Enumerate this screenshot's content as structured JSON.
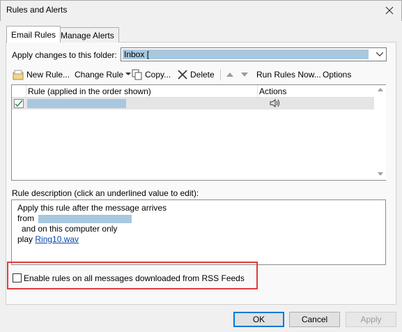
{
  "window": {
    "title": "Rules and Alerts"
  },
  "tabs": [
    {
      "label": "Email Rules",
      "active": true
    },
    {
      "label": "Manage Alerts",
      "active": false
    }
  ],
  "folder": {
    "label": "Apply changes to this folder:",
    "value": "Inbox ["
  },
  "toolbar": {
    "new_rule": "New Rule...",
    "change_rule": "Change Rule",
    "copy": "Copy...",
    "delete": "Delete",
    "run_rules_now": "Run Rules Now...",
    "options": "Options"
  },
  "rule_list": {
    "col_rule": "Rule (applied in the order shown)",
    "col_actions": "Actions",
    "rows": [
      {
        "checked": true,
        "actions_icon": "speaker-icon"
      }
    ]
  },
  "description": {
    "label": "Rule description (click an underlined value to edit):",
    "line1": "Apply this rule after the message arrives",
    "line2": "from",
    "line3": "and on this computer only",
    "line4_prefix": "play",
    "line4_link": "Ring10.wav"
  },
  "rss": {
    "label": "Enable rules on all messages downloaded from RSS Feeds",
    "checked": false
  },
  "buttons": {
    "ok": "OK",
    "cancel": "Cancel",
    "apply": "Apply"
  },
  "colors": {
    "highlight_border": "#e03c3c",
    "selection": "#a7c8de",
    "link": "#0645ad"
  }
}
